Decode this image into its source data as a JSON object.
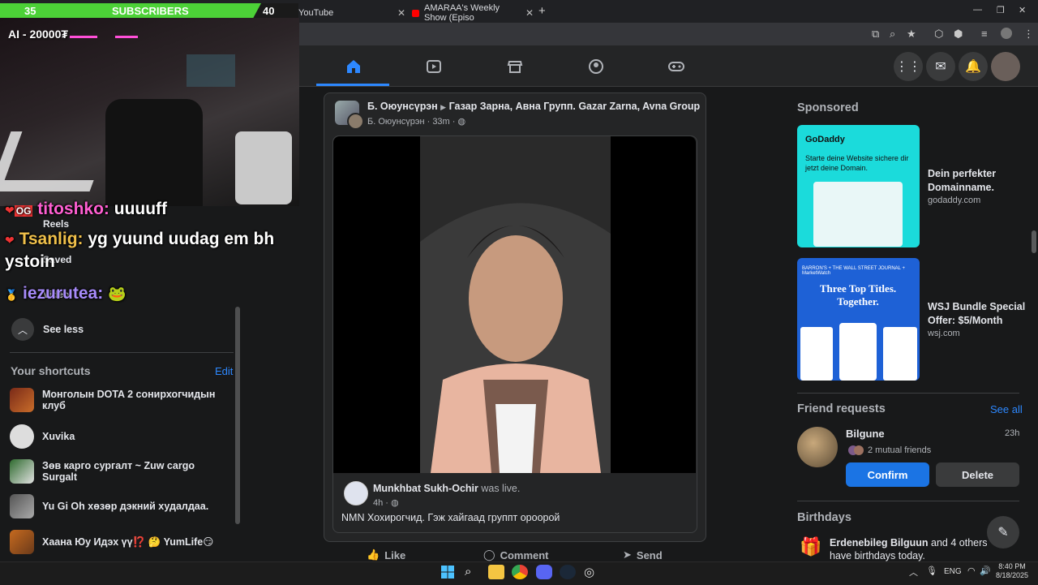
{
  "browser": {
    "tabs": [
      {
        "label": "YouTube"
      },
      {
        "label": "AMARAA's Weekly Show (Episo"
      }
    ],
    "new_tab": "+"
  },
  "overlay": {
    "sub_count": "35",
    "sub_label": "SUBSCRIBERS",
    "sub_goal": "40",
    "ai_label": "AI - 20000₮",
    "chat": [
      {
        "user": "titoshko:",
        "msg": "uuuuff"
      },
      {
        "user": "Tsanlig:",
        "msg": "yg yuund uudag em bh ystoin"
      },
      {
        "user": "iezurutea:",
        "msg": ""
      }
    ],
    "sub_progress": 0.875
  },
  "sidebar": {
    "reels": "Reels",
    "saved": "Saved",
    "video": "Video",
    "see_less": "See less",
    "shortcuts_title": "Your shortcuts",
    "edit": "Edit",
    "shortcuts": [
      {
        "label": "Монголын DOTA 2 сонирхогчидын клуб"
      },
      {
        "label": "Xuvika"
      },
      {
        "label": "Зөв карго сургалт ~ Zuw cargo Surgalt"
      },
      {
        "label": "Yu Gi Oh хөзөр дэкний худалдаа."
      },
      {
        "label": "Хаана Юу Идэх үү⁉️ 🤔 YumLife😏"
      }
    ]
  },
  "post": {
    "author": "Б. Оюунсүрэн",
    "group": "Газар Зарна, Авна Групп. Gazar Zarna, Avna Group",
    "sub_author": "Б. Оюунсүрэн",
    "time": "33m",
    "shared_author": "Munkhbat Sukh-Ochir",
    "shared_suffix": "was live.",
    "shared_time": "4h",
    "caption": "NMN Хохирогчид.  Гэж хайгаад группт ороорой",
    "actions": {
      "like": "Like",
      "comment": "Comment",
      "send": "Send"
    }
  },
  "right": {
    "sponsored": "Sponsored",
    "ads": [
      {
        "title": "Dein perfekter Domainname.",
        "domain": "godaddy.com",
        "img_brand": "GoDaddy",
        "img_text": "Starte deine Website sichere dir jetzt deine Domain."
      },
      {
        "title": "WSJ Bundle Special Offer: $5/Month",
        "domain": "wsj.com",
        "img_brand": "BARRON'S + THE WALL STREET JOURNAL + MarketWatch",
        "img_text": "Three Top Titles. Together."
      }
    ],
    "friend_requests": "Friend requests",
    "see_all": "See all",
    "friend": {
      "name": "Bilgune",
      "time": "23h",
      "mutual": "2 mutual friends"
    },
    "confirm": "Confirm",
    "delete": "Delete",
    "birthdays": "Birthdays",
    "birthday_text_name": "Erdenebileg Bilguun",
    "birthday_text_rest": " and 4 others have birthdays today."
  },
  "taskbar": {
    "lang": "ENG",
    "time": "8:40 PM",
    "date": "8/18/2025"
  },
  "colors": {
    "fb_blue": "#2d88ff",
    "accent_green": "#4cd137"
  }
}
